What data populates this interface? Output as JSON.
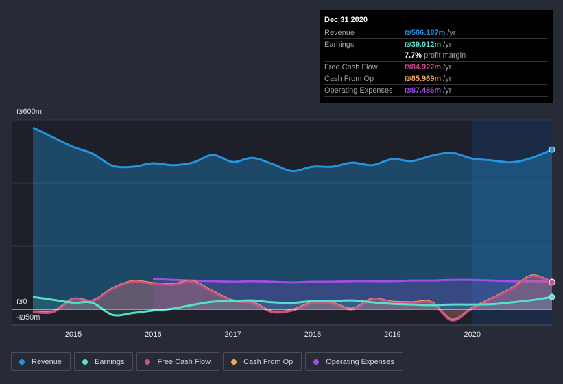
{
  "chart_data": {
    "type": "line",
    "x": [
      "2014-06-30",
      "2014-09-30",
      "2014-12-31",
      "2015-03-31",
      "2015-06-30",
      "2015-09-30",
      "2015-12-31",
      "2016-03-31",
      "2016-06-30",
      "2016-09-30",
      "2016-12-31",
      "2017-03-31",
      "2017-06-30",
      "2017-09-30",
      "2017-12-31",
      "2018-03-31",
      "2018-06-30",
      "2018-09-30",
      "2018-12-31",
      "2019-03-31",
      "2019-06-30",
      "2019-09-30",
      "2019-12-31",
      "2020-03-31",
      "2020-06-30",
      "2020-09-30",
      "2020-12-31"
    ],
    "series": [
      {
        "name": "Revenue",
        "color": "#2394df",
        "values": [
          576,
          545,
          515,
          493,
          455,
          452,
          463,
          457,
          465,
          489,
          467,
          480,
          461,
          438,
          452,
          452,
          465,
          457,
          476,
          470,
          487,
          496,
          478,
          472,
          466,
          480,
          506.187
        ]
      },
      {
        "name": "Earnings",
        "color": "#58e1c9",
        "values": [
          39,
          30,
          21,
          20,
          -18,
          -12,
          -4,
          2,
          14,
          24,
          26,
          28,
          22,
          20,
          26,
          26,
          28,
          22,
          17,
          15,
          13,
          15,
          15,
          16,
          22,
          29,
          39.012
        ]
      },
      {
        "name": "Free Cash Flow",
        "color": "#c94f8a",
        "values": [
          -9,
          -9,
          31,
          26,
          65,
          87,
          81,
          78,
          87,
          55,
          26,
          20,
          -9,
          -4,
          20,
          18,
          0,
          31,
          22,
          20,
          20,
          -35,
          2,
          33,
          65,
          105,
          84.922
        ]
      },
      {
        "name": "Cash From Op",
        "color": "#e9a95b",
        "values": [
          -7,
          -7,
          33,
          28,
          67,
          89,
          83,
          80,
          89,
          57,
          28,
          22,
          -7,
          -2,
          22,
          20,
          2,
          33,
          24,
          22,
          22,
          -33,
          4,
          35,
          67,
          107,
          85.969
        ]
      },
      {
        "name": "Operating Expenses",
        "color": "#9d4fe8",
        "values": [
          null,
          null,
          null,
          null,
          null,
          null,
          96,
          93,
          91,
          89,
          87,
          89,
          87,
          85,
          87,
          87,
          89,
          89,
          89,
          91,
          91,
          93,
          93,
          91,
          89,
          89,
          87.486
        ]
      }
    ],
    "y_tick_labels": [
      "₪600m",
      "₪0",
      "-₪50m"
    ],
    "x_tick_labels": [
      "2015",
      "2016",
      "2017",
      "2018",
      "2019",
      "2020"
    ],
    "ylim": [
      -50,
      600
    ],
    "xlim": [
      "2014-03-31",
      "2021-01-15"
    ],
    "highlight_from": "2020-01-01",
    "legend_position": "bottom-left"
  },
  "tooltip": {
    "date": "Dec 31 2020",
    "rows": [
      {
        "label": "Revenue",
        "value": "₪506.187m",
        "unit": "/yr",
        "color": "#2394df"
      },
      {
        "label": "Earnings",
        "value": "₪39.012m",
        "unit": "/yr",
        "color": "#58e1c9"
      },
      {
        "label": "",
        "value": "7.7%",
        "unit": "profit margin",
        "color": "#ffffff"
      },
      {
        "label": "Free Cash Flow",
        "value": "₪84.922m",
        "unit": "/yr",
        "color": "#c94f8a"
      },
      {
        "label": "Cash From Op",
        "value": "₪85.969m",
        "unit": "/yr",
        "color": "#e9a95b"
      },
      {
        "label": "Operating Expenses",
        "value": "₪87.486m",
        "unit": "/yr",
        "color": "#9d4fe8"
      }
    ]
  },
  "legend": [
    {
      "label": "Revenue",
      "color": "#2394df"
    },
    {
      "label": "Earnings",
      "color": "#58e1c9"
    },
    {
      "label": "Free Cash Flow",
      "color": "#c94f8a"
    },
    {
      "label": "Cash From Op",
      "color": "#e9a95b"
    },
    {
      "label": "Operating Expenses",
      "color": "#9d4fe8"
    }
  ]
}
